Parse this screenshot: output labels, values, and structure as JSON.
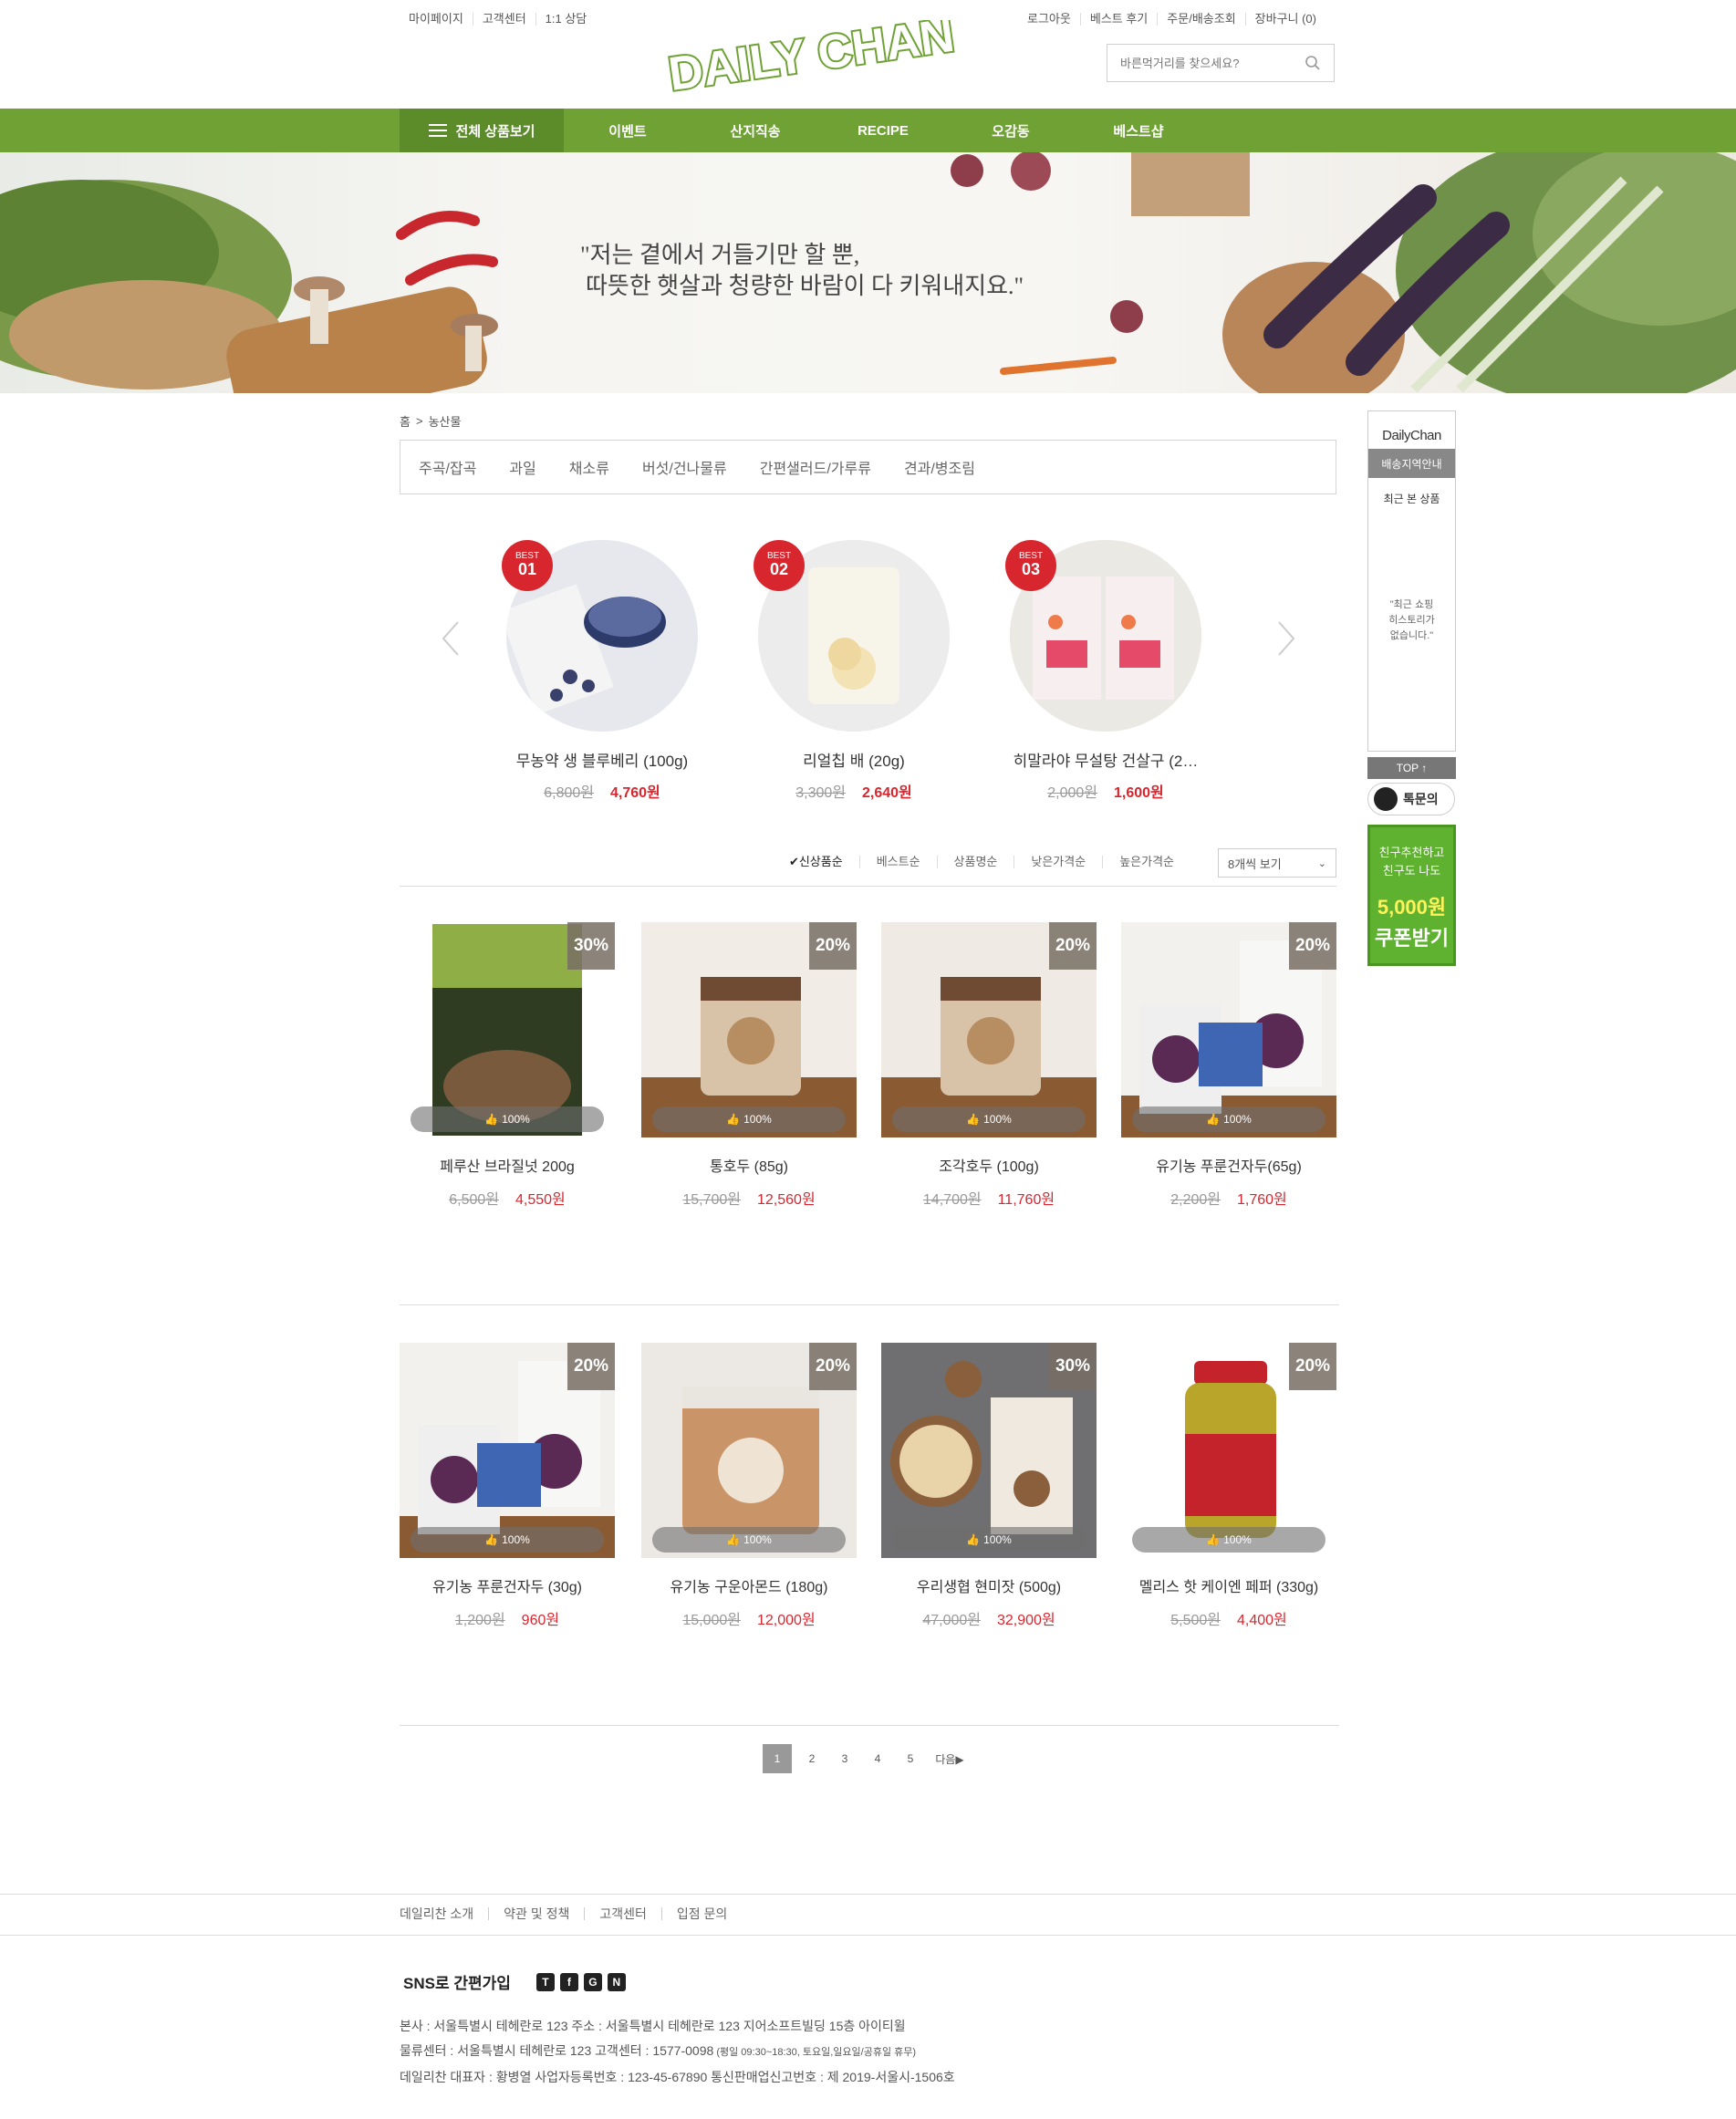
{
  "top_left_links": [
    "마이페이지",
    "고객센터",
    "1:1 상담"
  ],
  "top_right_links": [
    "로그아웃",
    "베스트 후기",
    "주문/배송조회",
    "장바구니 (0)"
  ],
  "logo_text": "DAILY CHAN",
  "search": {
    "placeholder": "바른먹거리를 찾으세요?"
  },
  "nav": {
    "all_label": "전체 상품보기",
    "items": [
      "이벤트",
      "산지직송",
      "RECIPE",
      "오감동",
      "베스트샵"
    ]
  },
  "banner": {
    "line1": "\"저는 곁에서 거들기만 할 뿐,",
    "line2": "따뜻한 햇살과 청량한 바람이 다 키워내지요.\""
  },
  "breadcrumb": {
    "home": "홈",
    "current": "농산물"
  },
  "categories": [
    "주곡/잡곡",
    "과일",
    "채소류",
    "버섯/건나물류",
    "간편샐러드/가루류",
    "견과/병조림"
  ],
  "best": [
    {
      "badge": "BEST",
      "rank": "01",
      "name": "무농약 생 블루베리 (100g)",
      "old_price": "6,800원",
      "price": "4,760원"
    },
    {
      "badge": "BEST",
      "rank": "02",
      "name": "리얼칩 배 (20g)",
      "old_price": "3,300원",
      "price": "2,640원"
    },
    {
      "badge": "BEST",
      "rank": "03",
      "name": "히말라야 무설탕 건살구 (2…",
      "old_price": "2,000원",
      "price": "1,600원"
    }
  ],
  "sort": {
    "options": [
      "✔신상품순",
      "베스트순",
      "상품명순",
      "낮은가격순",
      "높은가격순"
    ],
    "view": "8개씩 보기"
  },
  "products_row1": [
    {
      "name": "페루산 브라질넛 200g",
      "old_price": "6,500원",
      "price": "4,550원",
      "discount": "30%",
      "likes": "100%"
    },
    {
      "name": "통호두 (85g)",
      "old_price": "15,700원",
      "price": "12,560원",
      "discount": "20%",
      "likes": "100%"
    },
    {
      "name": "조각호두 (100g)",
      "old_price": "14,700원",
      "price": "11,760원",
      "discount": "20%",
      "likes": "100%"
    },
    {
      "name": "유기농 푸룬건자두(65g)",
      "old_price": "2,200원",
      "price": "1,760원",
      "discount": "20%",
      "likes": "100%"
    }
  ],
  "products_row2": [
    {
      "name": "유기농 푸룬건자두 (30g)",
      "old_price": "1,200원",
      "price": "960원",
      "discount": "20%",
      "likes": "100%"
    },
    {
      "name": "유기농 구운아몬드 (180g)",
      "old_price": "15,000원",
      "price": "12,000원",
      "discount": "20%",
      "likes": "100%"
    },
    {
      "name": "우리생협 현미잣 (500g)",
      "old_price": "47,000원",
      "price": "32,900원",
      "discount": "30%",
      "likes": "100%"
    },
    {
      "name": "멜리스 핫 케이엔 페퍼 (330g)",
      "old_price": "5,500원",
      "price": "4,400원",
      "discount": "20%",
      "likes": "100%"
    }
  ],
  "pagination": {
    "pages": [
      "1",
      "2",
      "3",
      "4",
      "5"
    ],
    "next": "다음▶"
  },
  "footer": {
    "links": [
      "데일리찬 소개",
      "약관 및 정책",
      "고객센터",
      "입점 문의"
    ],
    "sns_label": "SNS로 간편가입",
    "sns_icons": [
      "T",
      "f",
      "G",
      "N"
    ],
    "addr1": "본사 : 서울특별시 테헤란로 123    주소 : 서울특별시 테헤란로 123 지어소프트빌딩 15층 아이티윌",
    "addr2": "물류센터 : 서울특별시 테헤란로 123    고객센터 : 1577-0098",
    "addr2_small": " (평일 09:30~18:30, 토요일,일요일/공휴일 휴무)",
    "addr3": "데일리찬 대표자 : 황병열    사업자등록번호 : 123-45-67890    통신판매업신고번호 : 제 2019-서울시-1506호"
  },
  "sidebar": {
    "logo": "DailyChan",
    "delivery": "배송지역안내",
    "recent": "최근 본 상품",
    "empty_line1": "\"최근 쇼핑",
    "empty_line2": "히스토리가",
    "empty_line3": "없습니다.\"",
    "top": "TOP ↑",
    "talk": "톡문의",
    "coupon_line1": "친구추천하고",
    "coupon_line2": "친구도 나도",
    "coupon_amount": "5,000원",
    "coupon_cta": "쿠폰받기"
  },
  "colors": {
    "brand_green": "#6fa134",
    "sale_red": "#d8262f"
  }
}
